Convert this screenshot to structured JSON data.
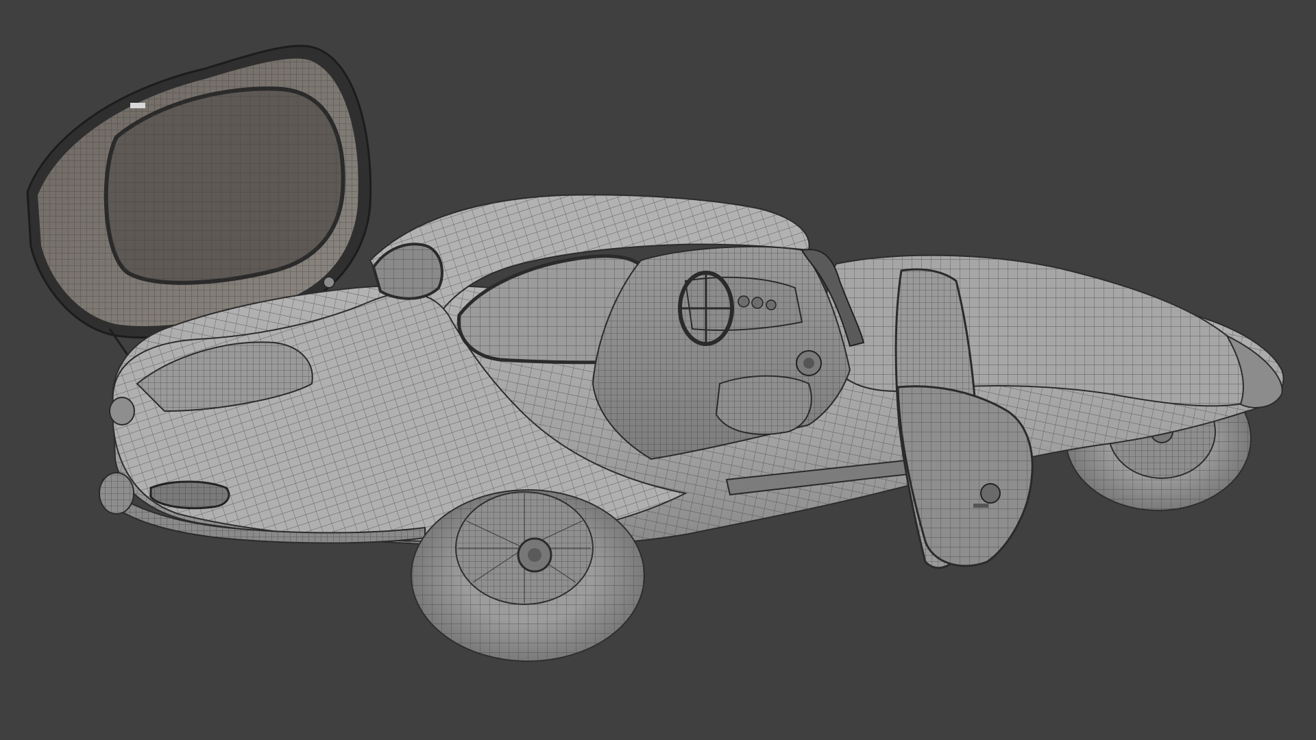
{
  "viewport": {
    "background": "#404040",
    "shading_mode": "wireframe-on-shaded",
    "mesh_base_color": "#a9a9a9",
    "wire_color": "#3e3e3e"
  },
  "scene": {
    "object": "car-3d-model",
    "parts": [
      "body-shell",
      "rear-hatch-open",
      "rear-window",
      "cabin-glass",
      "windshield",
      "dashboard",
      "steering-wheel",
      "seats",
      "door-open",
      "front-bonnet",
      "rear-wheel",
      "front-wheel",
      "rear-bumper",
      "tail-light",
      "hatch-strut"
    ]
  }
}
